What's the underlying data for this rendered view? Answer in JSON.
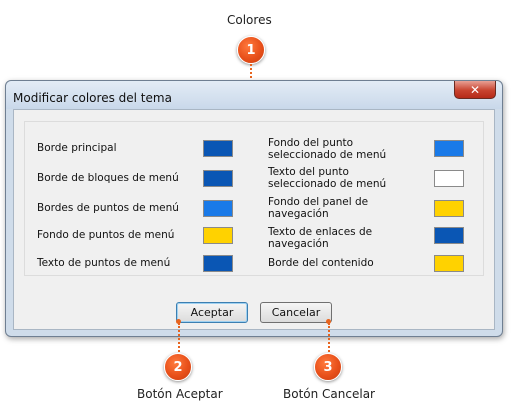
{
  "callouts": {
    "colores": {
      "number": "1",
      "label": "Colores"
    },
    "aceptar": {
      "number": "2",
      "label": "Botón Aceptar"
    },
    "cancelar": {
      "number": "3",
      "label": "Botón Cancelar"
    }
  },
  "window": {
    "title": "Modificar colores del tema",
    "close_label": "✕"
  },
  "colors": {
    "left": [
      {
        "label": "Borde principal",
        "color": "#0a56b4"
      },
      {
        "label": "Borde de bloques de menú",
        "color": "#0a56b4"
      },
      {
        "label": "Bordes de puntos de menú",
        "color": "#1a7ae8"
      },
      {
        "label": "Fondo de puntos de menú",
        "color": "#ffd200"
      },
      {
        "label": "Texto de puntos de menú",
        "color": "#0a56b4"
      }
    ],
    "right": [
      {
        "label": "Fondo del punto seleccionado de menú",
        "color": "#1a7ae8"
      },
      {
        "label": "Texto del punto seleccionado de menú",
        "color": "#ffffff"
      },
      {
        "label": "Fondo del panel de navegación",
        "color": "#ffd200"
      },
      {
        "label": "Texto de enlaces de navegación",
        "color": "#0a56b4"
      },
      {
        "label": "Borde del contenido",
        "color": "#ffd200"
      }
    ]
  },
  "buttons": {
    "accept": "Aceptar",
    "cancel": "Cancelar"
  },
  "accent": "#e8641e"
}
